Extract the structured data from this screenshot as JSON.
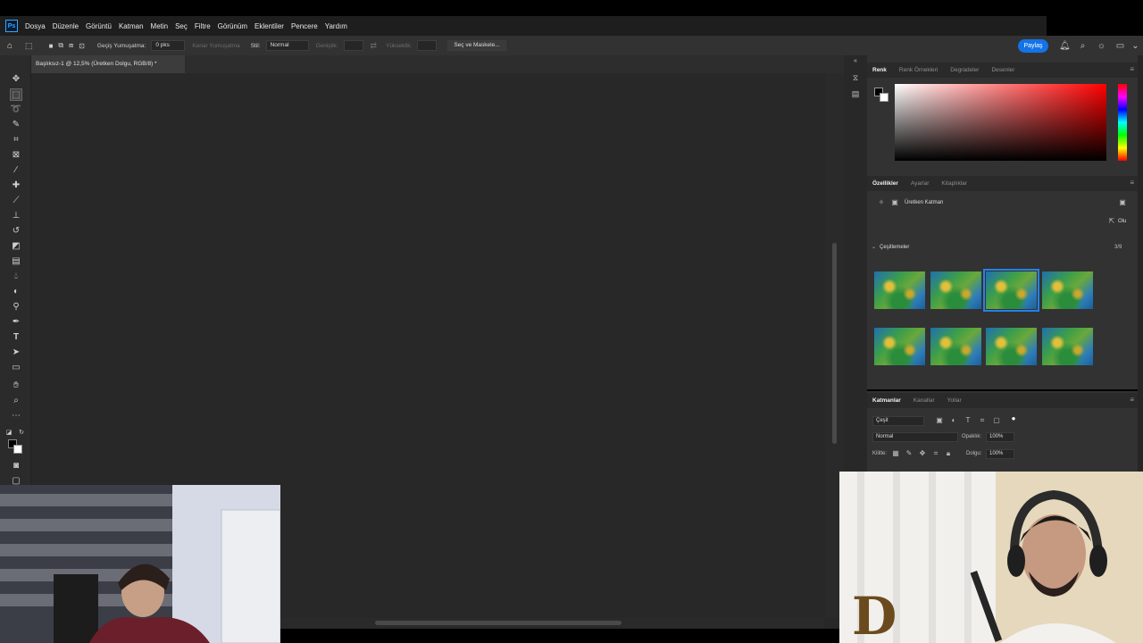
{
  "app": {
    "logo": "Ps",
    "menu": [
      "Dosya",
      "Düzenle",
      "Görüntü",
      "Katman",
      "Metin",
      "Seç",
      "Filtre",
      "Görünüm",
      "Eklentiler",
      "Pencere",
      "Yardım"
    ]
  },
  "options_bar": {
    "feather_label": "Geçiş Yumuşatma:",
    "feather_value": "0 pks",
    "antialias_label": "Kenar Yumuşatma",
    "style_label": "Stil:",
    "style_value": "Normal",
    "width_label": "Genişlik:",
    "height_label": "Yükseklik:",
    "select_mask_button": "Seç ve Maskele...",
    "share_button": "Paylaş"
  },
  "document": {
    "tab_title": "Başlıksız-1 @ 12,5% (Üretken Dolgu, RGB/8) *"
  },
  "color_panel": {
    "tabs": [
      "Renk",
      "Renk Örnekleri",
      "Degradeler",
      "Desenler"
    ],
    "active_tab": "Renk",
    "foreground": "#000000",
    "background": "#ffffff",
    "hue": "#ff0000"
  },
  "properties_panel": {
    "tabs": [
      "Özellikler",
      "Ayarlar",
      "Kitaplıklar"
    ],
    "active_tab": "Özellikler",
    "layer_type": "Üretken Katman",
    "generate_button": "Olu",
    "variations_label": "Çeşitlemeler",
    "variations_count": "3/9",
    "selected_variation": 3,
    "variation_count_shown": 8
  },
  "layers_panel": {
    "tabs": [
      "Katmanlar",
      "Kanallar",
      "Yollar"
    ],
    "active_tab": "Katmanlar",
    "filter_label": "Çeşit",
    "blend_mode": "Normal",
    "opacity_label": "Opaklık:",
    "opacity_value": "100%",
    "lock_label": "Kilitle:",
    "fill_label": "Dolgu:",
    "fill_value": "100%"
  }
}
